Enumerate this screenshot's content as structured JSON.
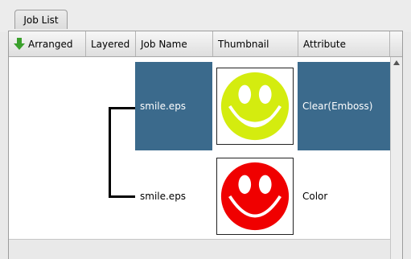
{
  "tabs": [
    {
      "label": "Job List"
    }
  ],
  "columns": {
    "arranged": "Arranged",
    "layered": "Layered",
    "job_name": "Job Name",
    "thumbnail": "Thumbnail",
    "attribute": "Attribute"
  },
  "rows": [
    {
      "job_name": "smile.eps",
      "attribute": "Clear(Emboss)",
      "thumbnail": "smiley-yellow-green",
      "thumb_color": "#d4ec0f",
      "selected": true
    },
    {
      "job_name": "smile.eps",
      "attribute": "Color",
      "thumbnail": "smiley-red",
      "thumb_color": "#f00000",
      "selected": false
    }
  ],
  "colors": {
    "selection": "#3b6a8c",
    "arrow": "#3aa02c"
  },
  "icons": {
    "sort": "down-arrow-icon",
    "scroll_up": "scroll-up-arrow-icon"
  }
}
